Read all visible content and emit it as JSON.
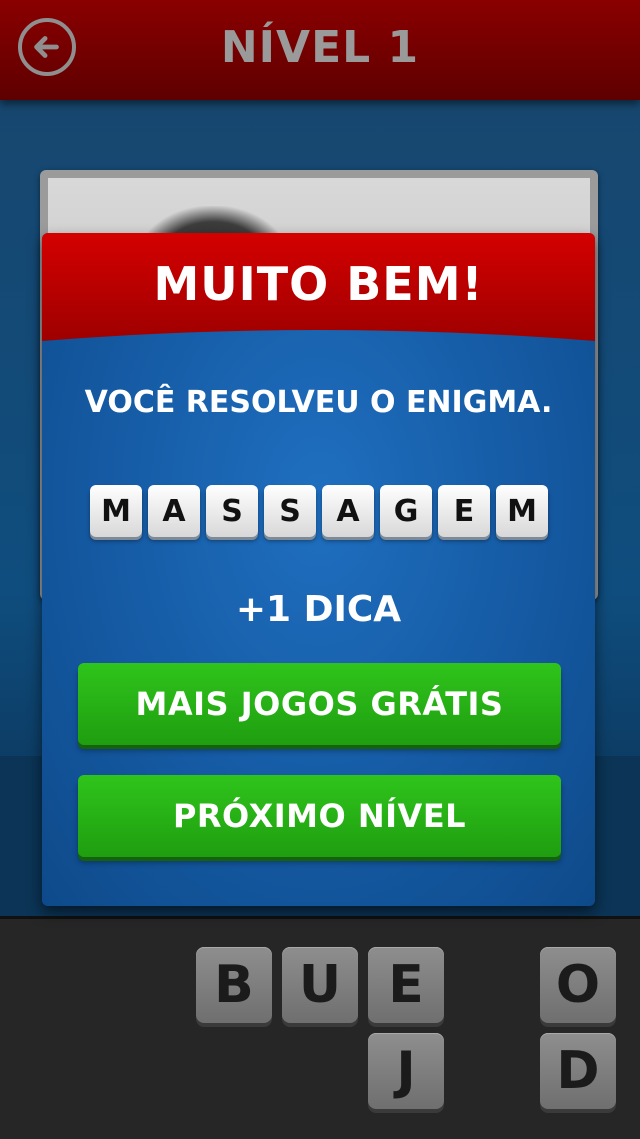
{
  "header": {
    "title": "NÍVEL 1",
    "back_icon": "back-arrow-icon"
  },
  "modal": {
    "title": "MUITO BEM!",
    "subtitle": "VOCÊ RESOLVEU O ENIGMA.",
    "answer": [
      "M",
      "A",
      "S",
      "S",
      "A",
      "G",
      "E",
      "M"
    ],
    "reward": "+1 DICA",
    "more_games_label": "MAIS JOGOS GRÁTIS",
    "next_level_label": "PRÓXIMO NÍVEL"
  },
  "keyboard": {
    "keys": [
      "B",
      "U",
      "E",
      "O",
      "J",
      "D"
    ]
  },
  "colors": {
    "header_bg": "#6e0000",
    "modal_header": "#c00000",
    "modal_bg": "#155aa3",
    "button_green": "#23ad14"
  }
}
